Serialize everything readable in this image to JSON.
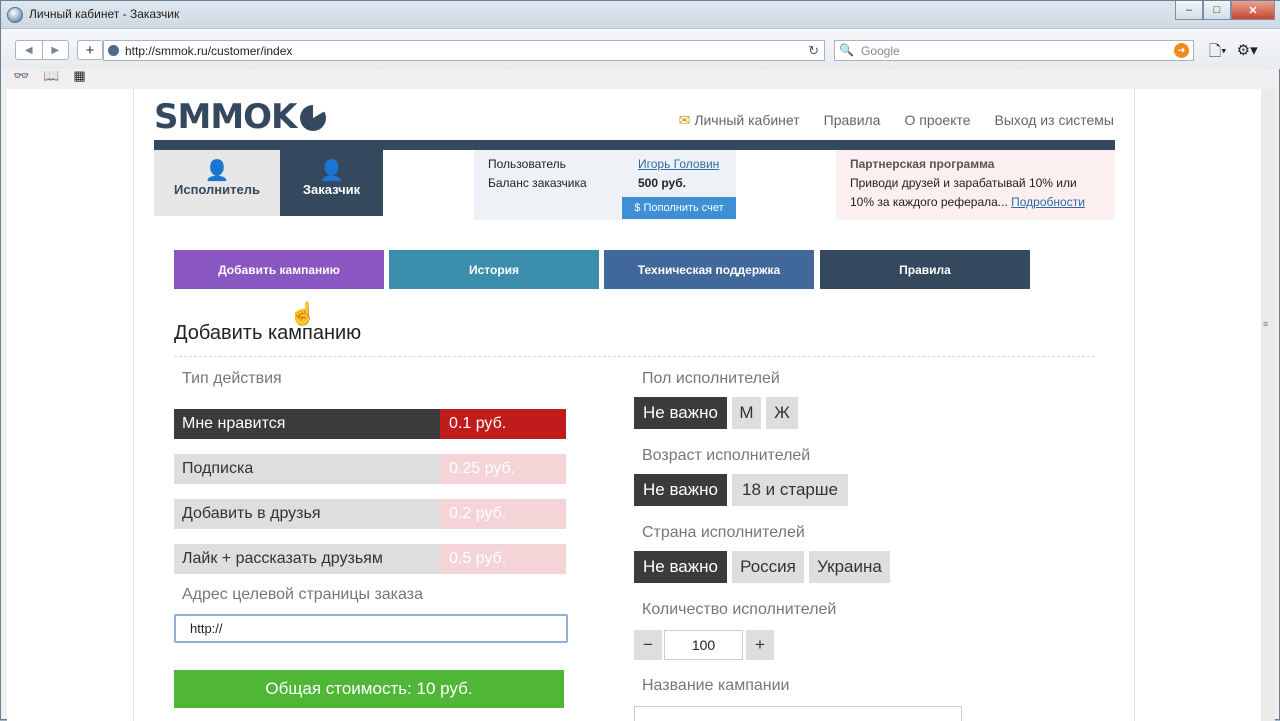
{
  "window": {
    "title": "Личный кабинет - Заказчик",
    "controls": [
      "–",
      "□",
      "✕"
    ]
  },
  "browser": {
    "url": "http://smmok.ru/customer/index",
    "search_placeholder": "Google",
    "back": "◀",
    "forward": "▶",
    "add_tab": "+",
    "reload": "↻",
    "page_menu": "🗋▾",
    "tools_menu": "⚙▾",
    "bookmarks": [
      "👓",
      "📖",
      "▦"
    ]
  },
  "site": {
    "logo": "SMMOK",
    "top_nav": {
      "cabinet_icon": "✉",
      "cabinet": "Личный кабинет",
      "rules": "Правила",
      "about": "О проекте",
      "logout": "Выход из системы"
    },
    "roles": {
      "executor": "Исполнитель",
      "executor_icon": "👤",
      "customer": "Заказчик",
      "customer_icon": "👤"
    },
    "user": {
      "user_label": "Пользователь",
      "user_name": "Игорь Головин",
      "balance_label": "Баланс заказчика",
      "balance_value": "500 руб.",
      "topup_button": "$ Пополнить счет"
    },
    "partner": {
      "heading": "Партнерская программа",
      "text": "Приводи друзей и зарабатывай 10% или 10% за каждого реферала...",
      "link": "Подробности"
    },
    "menu": [
      {
        "label": "Добавить кампанию",
        "color": "#8a56c2"
      },
      {
        "label": "История",
        "color": "#3b8eab"
      },
      {
        "label": "Техническая поддержка",
        "color": "#40689a"
      },
      {
        "label": "Правила",
        "color": "#34495e"
      }
    ]
  },
  "form": {
    "title": "Добавить кампанию",
    "action_label": "Тип действия",
    "actions": [
      {
        "name": "Мне нравится",
        "price": "0.1 руб.",
        "selected": true
      },
      {
        "name": "Подписка",
        "price": "0.25 руб.",
        "selected": false
      },
      {
        "name": "Добавить в друзья",
        "price": "0.2 руб.",
        "selected": false
      },
      {
        "name": "Лайк + рассказать друзьям",
        "price": "0.5 руб.",
        "selected": false
      }
    ],
    "url_label": "Адрес целевой страницы заказа",
    "url_value": "http://",
    "total": "Общая стоимость: 10 руб.",
    "gender": {
      "label": "Пол исполнителей",
      "options": [
        "Не важно",
        "М",
        "Ж"
      ],
      "selected": 0
    },
    "age": {
      "label": "Возраст исполнителей",
      "options": [
        "Не важно",
        "18 и старше"
      ],
      "selected": 0
    },
    "country": {
      "label": "Страна исполнителей",
      "options": [
        "Не важно",
        "Россия",
        "Украина"
      ],
      "selected": 0
    },
    "count": {
      "label": "Количество исполнителей",
      "minus": "−",
      "value": "100",
      "plus": "+"
    },
    "campaign_name_label": "Название кампании"
  }
}
